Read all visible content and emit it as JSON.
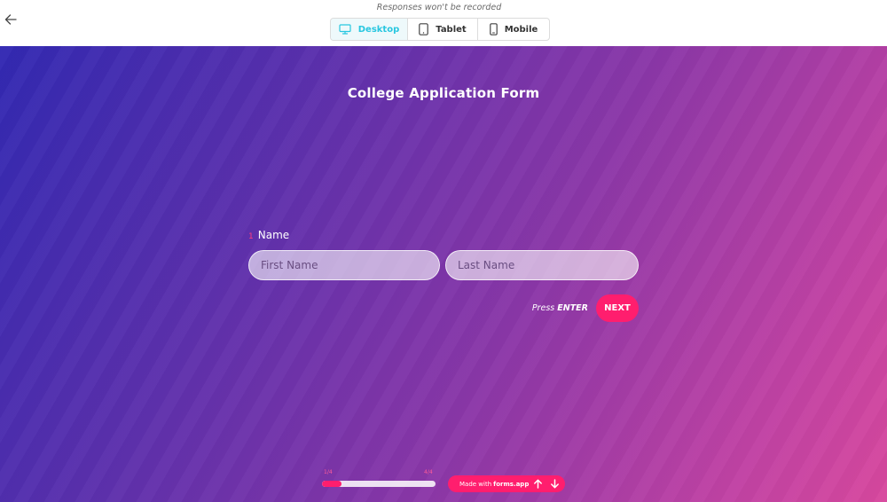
{
  "preview": {
    "notice": "Responses won't be recorded",
    "devices": [
      {
        "label": "Desktop",
        "icon": "desktop-icon",
        "active": true
      },
      {
        "label": "Tablet",
        "icon": "tablet-icon",
        "active": false
      },
      {
        "label": "Mobile",
        "icon": "mobile-icon",
        "active": false
      }
    ]
  },
  "form": {
    "title": "College Application Form",
    "question": {
      "number": "1",
      "label": "Name",
      "first_placeholder": "First Name",
      "last_placeholder": "Last Name"
    },
    "press_prefix": "Press",
    "press_key": "ENTER",
    "next_label": "NEXT"
  },
  "progress": {
    "start_label": "1/4",
    "end_label": "4/4",
    "fraction": 0.17
  },
  "branding": {
    "made_with": "Made with",
    "brand": "forms.app"
  },
  "colors": {
    "accent": "#ff1e6e",
    "device_active": "#28c7e0",
    "gradient_start": "#3229b2",
    "gradient_end": "#d8489e"
  }
}
